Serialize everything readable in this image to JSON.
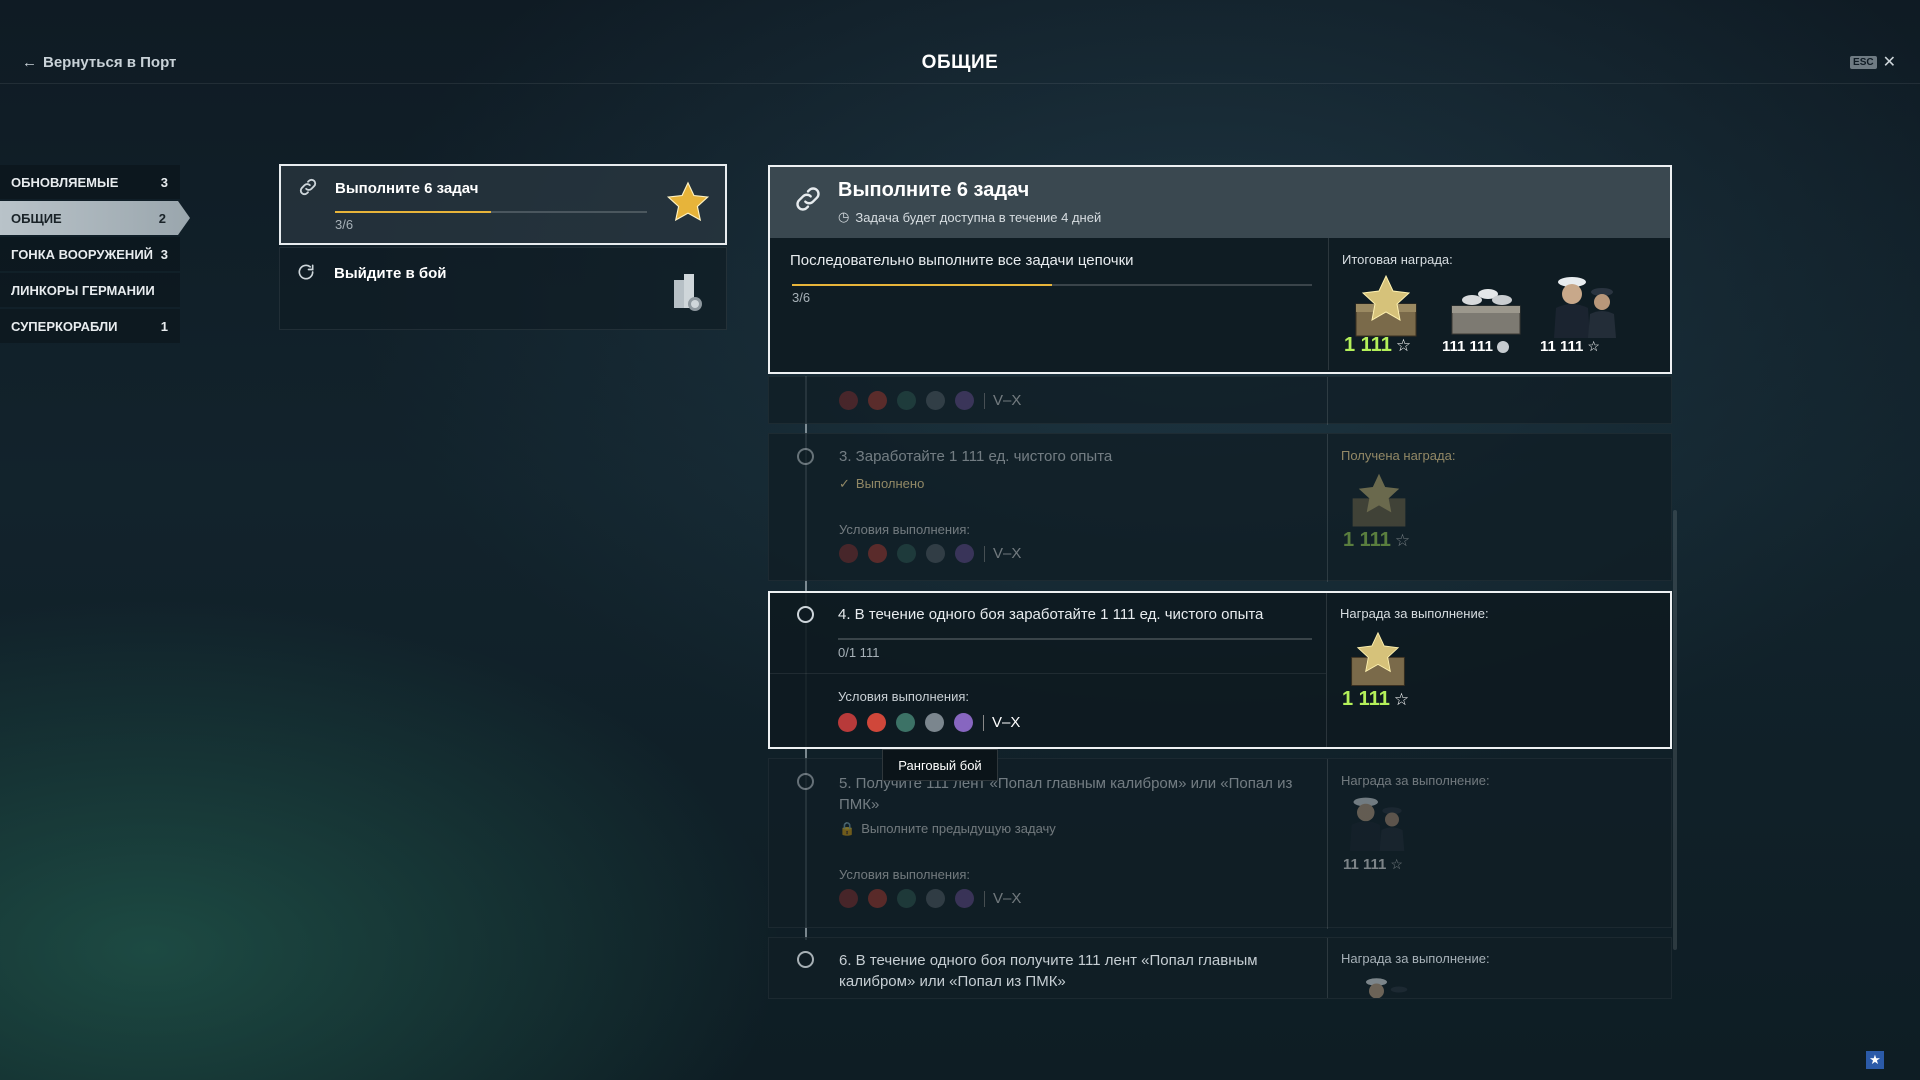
{
  "header": {
    "back_label": "Вернуться в Порт",
    "title": "ОБЩИЕ",
    "esc_label": "ESC"
  },
  "sidebar": {
    "items": [
      {
        "label": "ОБНОВЛЯЕМЫЕ",
        "count": "3"
      },
      {
        "label": "ОБЩИЕ",
        "count": "2"
      },
      {
        "label": "ГОНКА ВООРУЖЕНИЙ",
        "count": "3"
      },
      {
        "label": "ЛИНКОРЫ ГЕРМАНИИ",
        "count": ""
      },
      {
        "label": "СУПЕРКОРАБЛИ",
        "count": "1"
      }
    ]
  },
  "left_cards": [
    {
      "title": "Выполните 6 задач",
      "progress_text": "3/6",
      "progress": 0.5
    },
    {
      "title": "Выйдите в бой"
    }
  ],
  "detail": {
    "title": "Выполните 6 задач",
    "subtitle": "Задача будет доступна в течение 4 дней",
    "description": "Последовательно выполните все задачи цепочки",
    "progress_text": "3/6",
    "progress": 0.5,
    "final_reward_label": "Итоговая награда:",
    "rewards": [
      {
        "value": "1 111",
        "type": "star-container"
      },
      {
        "value": "111 111",
        "type": "silver"
      },
      {
        "value": "11 111",
        "type": "commanders"
      }
    ]
  },
  "tasks": {
    "t2": {
      "tier": "V–X"
    },
    "t3": {
      "title": "3. Заработайте 1 111 ед. чистого опыта",
      "status": "Выполнено",
      "conditions_label": "Условия выполнения:",
      "tier": "V–X",
      "reward_label": "Получена награда:",
      "reward_value": "1 111"
    },
    "t4": {
      "title": "4. В течение одного боя заработайте 1 111 ед. чистого опыта",
      "progress_text": "0/1 111",
      "conditions_label": "Условия выполнения:",
      "tier": "V–X",
      "reward_label": "Награда за выполнение:",
      "reward_value": "1 111"
    },
    "t5": {
      "title": "5. Получите 111 лент «Попал главным калибром» или «Попал из ПМК»",
      "status": "Выполните предыдущую задачу",
      "conditions_label": "Условия выполнения:",
      "tier": "V–X",
      "reward_label": "Награда за выполнение:",
      "reward_value": "11 111"
    },
    "t6": {
      "title": "6. В течение одного боя получите 111 лент «Попал главным калибром» или «Попал из ПМК»",
      "reward_label": "Награда за выполнение:"
    }
  },
  "tooltip": {
    "text": "Ранговый бой"
  },
  "colors": {
    "accent_gold": "#e7b43a",
    "reward_green": "#b4f05a",
    "selected_border": "#eef1f3"
  }
}
